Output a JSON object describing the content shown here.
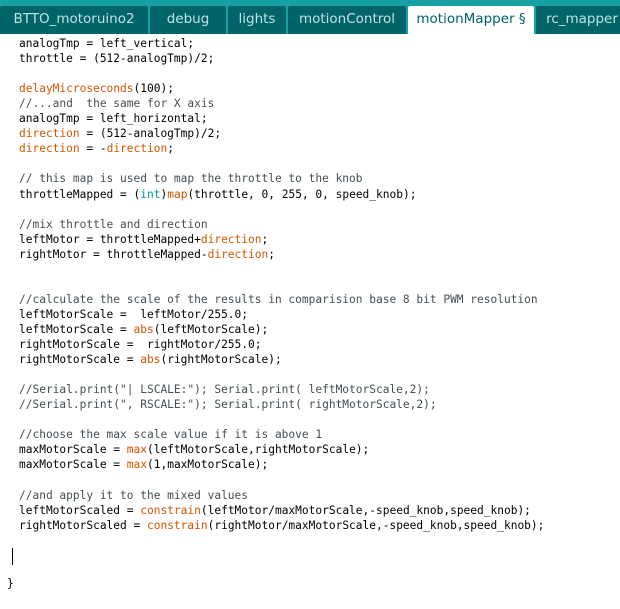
{
  "tabs": [
    {
      "label": "BTTO_motoruino2",
      "active": false
    },
    {
      "label": "debug",
      "active": false
    },
    {
      "label": "lights",
      "active": false
    },
    {
      "label": "motionControl",
      "active": false
    },
    {
      "label": "motionMapper §",
      "active": true
    },
    {
      "label": "rc_mapper",
      "active": false
    }
  ],
  "colors": {
    "tab_bar": "#17a1a5",
    "tab_inactive": "#006468",
    "tab_active": "#ffffff",
    "function_keyword": "#d35400",
    "type_keyword": "#00979c",
    "comment": "#434f54"
  },
  "code": {
    "lines": [
      "analogTmp = left_vertical;",
      "throttle = (512-analogTmp)/2;",
      "",
      "delayMicroseconds(100);",
      "//...and  the same for X axis",
      "analogTmp = left_horizontal;",
      "direction = (512-analogTmp)/2;",
      "direction = -direction;",
      "",
      "// this map is used to map the throttle to the knob",
      "throttleMapped = (int)map(throttle, 0, 255, 0, speed_knob);",
      "",
      "//mix throttle and direction",
      "leftMotor = throttleMapped+direction;",
      "rightMotor = throttleMapped-direction;",
      "",
      "",
      "//calculate the scale of the results in comparision base 8 bit PWM resolution",
      "leftMotorScale =  leftMotor/255.0;",
      "leftMotorScale = abs(leftMotorScale);",
      "rightMotorScale =  rightMotor/255.0;",
      "rightMotorScale = abs(rightMotorScale);",
      "",
      "//Serial.print(\"| LSCALE:\"); Serial.print( leftMotorScale,2);",
      "//Serial.print(\", RSCALE:\"); Serial.print( rightMotorScale,2);",
      "",
      "//choose the max scale value if it is above 1",
      "maxMotorScale = max(leftMotorScale,rightMotorScale);",
      "maxMotorScale = max(1,maxMotorScale);",
      "",
      "//and apply it to the mixed values",
      "leftMotorScaled = constrain(leftMotor/maxMotorScale,-speed_knob,speed_knob);",
      "rightMotorScaled = constrain(rightMotor/maxMotorScale,-speed_knob,speed_knob);"
    ],
    "closing_brace": "}"
  }
}
